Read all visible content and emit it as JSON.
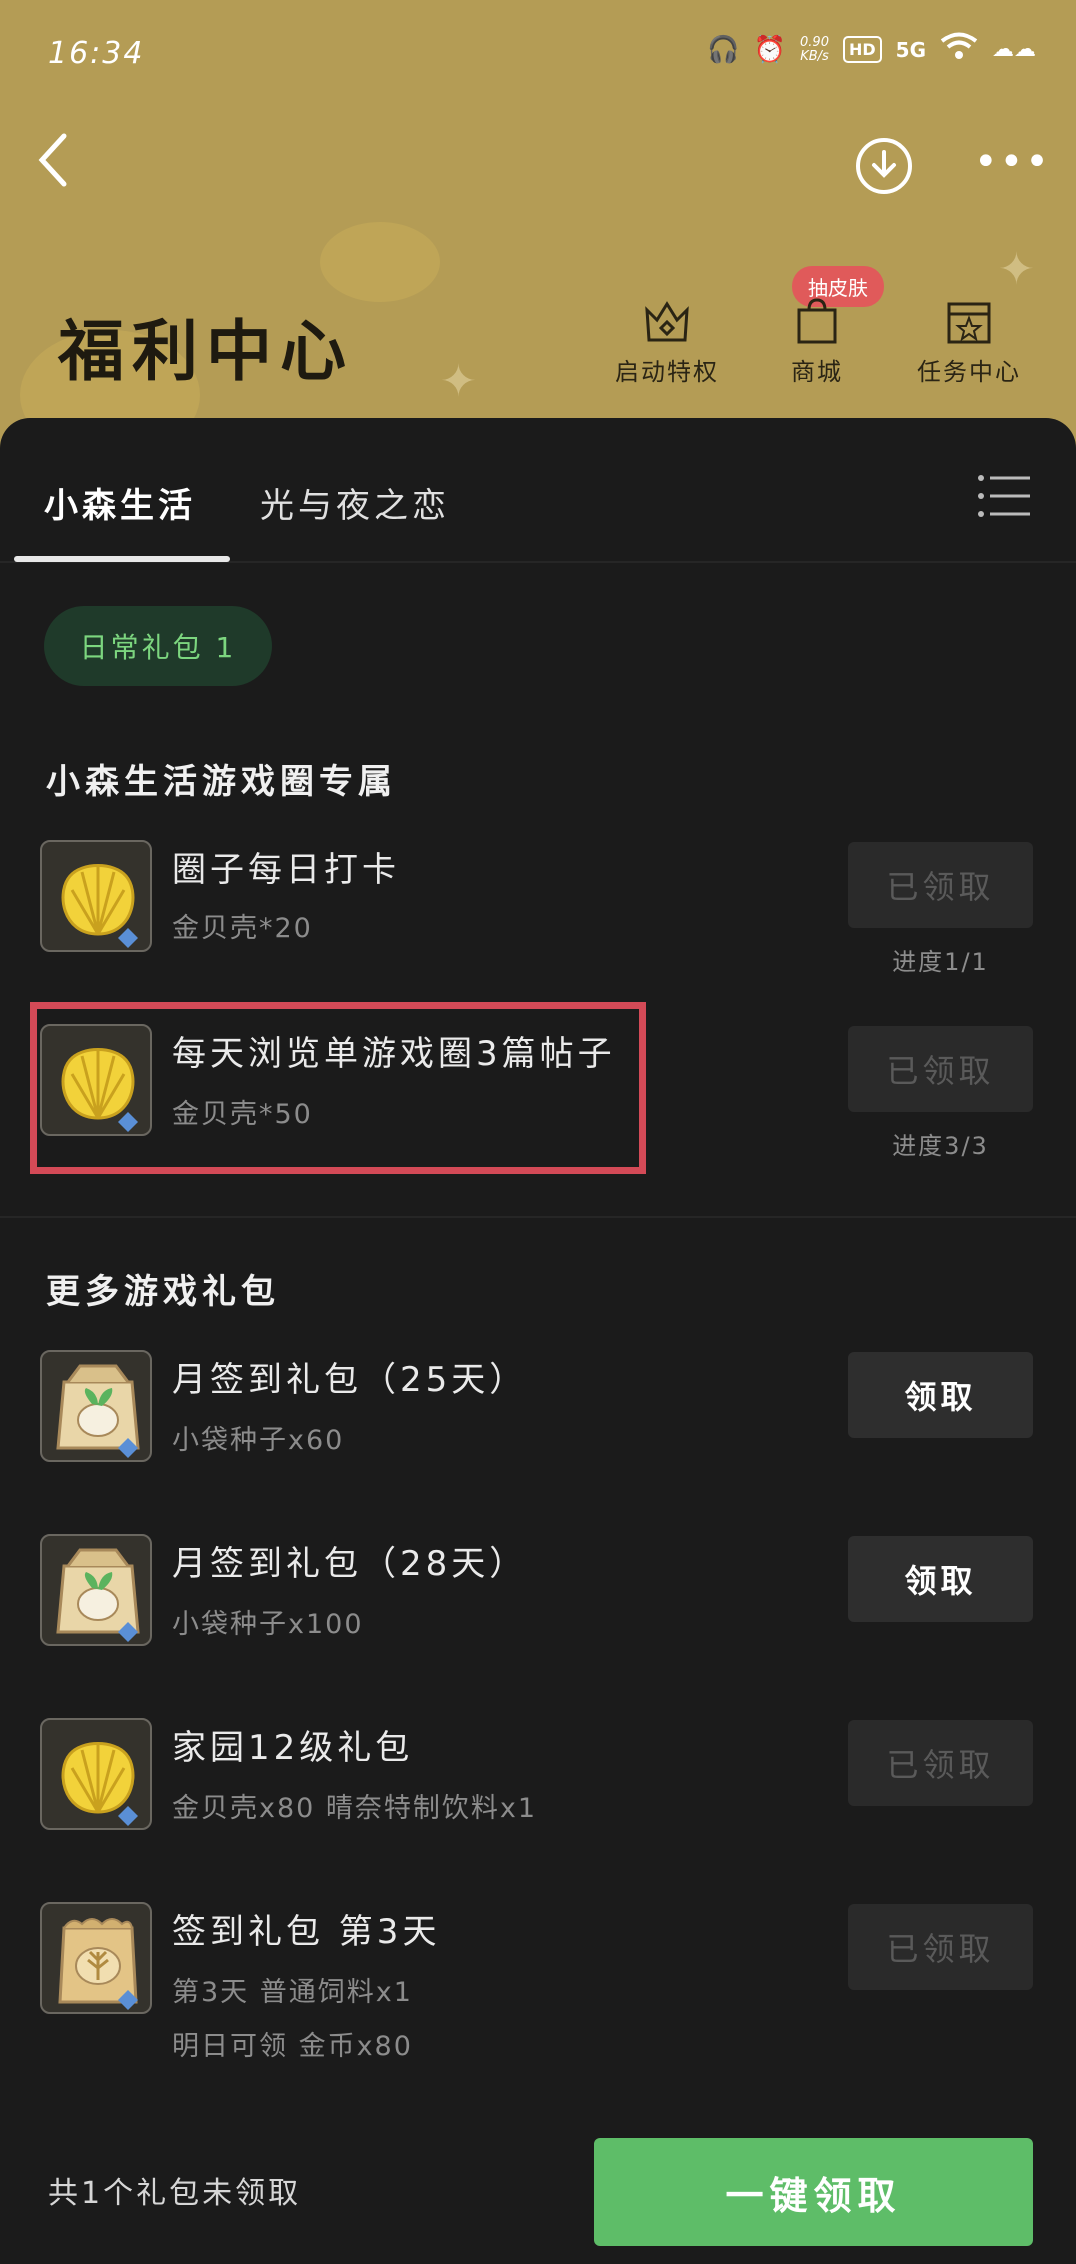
{
  "status": {
    "time": "16:34",
    "net_speed": "0.90",
    "net_unit": "KB/s",
    "hd": "HD",
    "signal": "5G"
  },
  "header": {
    "title": "福利中心",
    "nav": [
      {
        "label": "启动特权",
        "icon": "crown-icon"
      },
      {
        "label": "商城",
        "icon": "shopping-bag-icon",
        "badge": "抽皮肤"
      },
      {
        "label": "任务中心",
        "icon": "calendar-star-icon"
      }
    ]
  },
  "tabs": [
    "小森生活",
    "光与夜之恋"
  ],
  "pill": "日常礼包 1",
  "sections": [
    {
      "title": "小森生活游戏圈专属",
      "items": [
        {
          "name": "圈子每日打卡",
          "sub": [
            "金贝壳*20"
          ],
          "button": "已领取",
          "progress": "进度1/1",
          "icon": "gold-shell-icon"
        },
        {
          "name": "每天浏览单游戏圈3篇帖子",
          "sub": [
            "金贝壳*50"
          ],
          "button": "已领取",
          "progress": "进度3/3",
          "icon": "gold-shell-icon"
        }
      ]
    },
    {
      "title": "更多游戏礼包",
      "items": [
        {
          "name": "月签到礼包（25天）",
          "sub": [
            "小袋种子x60"
          ],
          "button": "领取",
          "icon": "seed-bag-icon"
        },
        {
          "name": "月签到礼包（28天）",
          "sub": [
            "小袋种子x100"
          ],
          "button": "领取",
          "icon": "seed-bag-icon"
        },
        {
          "name": "家园12级礼包",
          "sub": [
            "金贝壳x80 晴奈特制饮料x1"
          ],
          "button": "已领取",
          "icon": "gold-shell-icon"
        },
        {
          "name": "签到礼包 第3天",
          "sub": [
            "第3天 普通饲料x1",
            "明日可领 金币x80"
          ],
          "button": "已领取",
          "icon": "feed-bag-icon"
        }
      ]
    }
  ],
  "footer": {
    "summary": "共1个礼包未领取",
    "claim_all": "一键领取"
  },
  "colors": {
    "header_bg": "#b49c55",
    "sheet_bg": "#1b1b1b",
    "accent_green": "#5ebd68",
    "highlight_red": "#d44a57",
    "badge_red": "#e05a5a"
  }
}
